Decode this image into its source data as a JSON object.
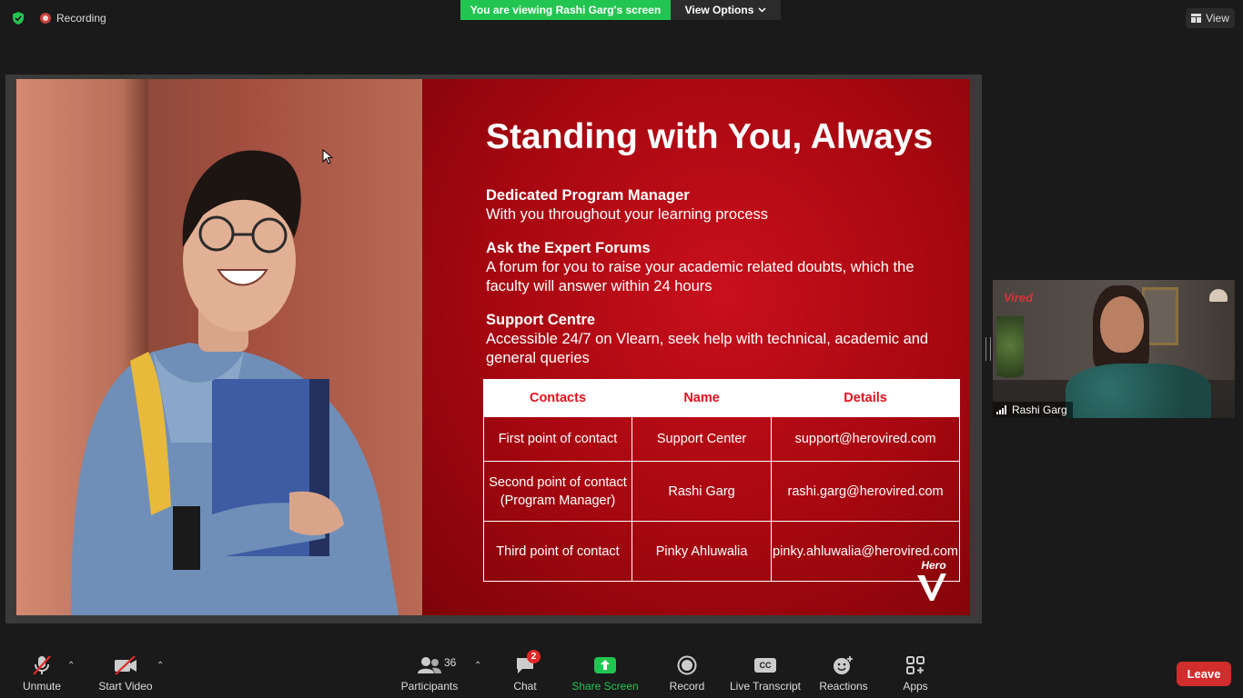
{
  "top_bar": {
    "recording_label": "Recording",
    "viewing_banner": "You are viewing Rashi Garg's screen",
    "view_options_label": "View Options",
    "view_label": "View"
  },
  "slide": {
    "title": "Standing with You, Always",
    "sections": [
      {
        "heading": "Dedicated Program Manager",
        "text": "With you throughout your learning process"
      },
      {
        "heading": "Ask the Expert Forums",
        "text": "A forum for you to raise your academic related doubts, which the faculty will answer within 24 hours"
      },
      {
        "heading": "Support Centre",
        "text": "Accessible 24/7 on Vlearn, seek help with technical, academic and general queries"
      }
    ],
    "table": {
      "headers": [
        "Contacts",
        "Name",
        "Details"
      ],
      "rows": [
        [
          "First point of contact",
          "Support Center",
          "support@herovired.com"
        ],
        [
          "Second point of contact (Program Manager)",
          "Rashi Garg",
          "rashi.garg@herovired.com"
        ],
        [
          "Third point of contact",
          "Pinky Ahluwalia",
          "pinky.ahluwalia@herovired.com"
        ]
      ]
    },
    "logo_text": "Hero"
  },
  "participant_tile": {
    "name": "Rashi Garg",
    "background_logo_text": "Vired"
  },
  "toolbar": {
    "unmute_label": "Unmute",
    "start_video_label": "Start Video",
    "participants_label": "Participants",
    "participants_count": "36",
    "chat_label": "Chat",
    "chat_badge": "2",
    "share_screen_label": "Share Screen",
    "record_label": "Record",
    "live_transcript_label": "Live Transcript",
    "cc_text": "CC",
    "reactions_label": "Reactions",
    "apps_label": "Apps",
    "leave_label": "Leave"
  },
  "colors": {
    "share_green": "#23c552",
    "leave_red": "#d12d2d",
    "slide_red": "#a50710",
    "table_header_text": "#e0101c"
  }
}
